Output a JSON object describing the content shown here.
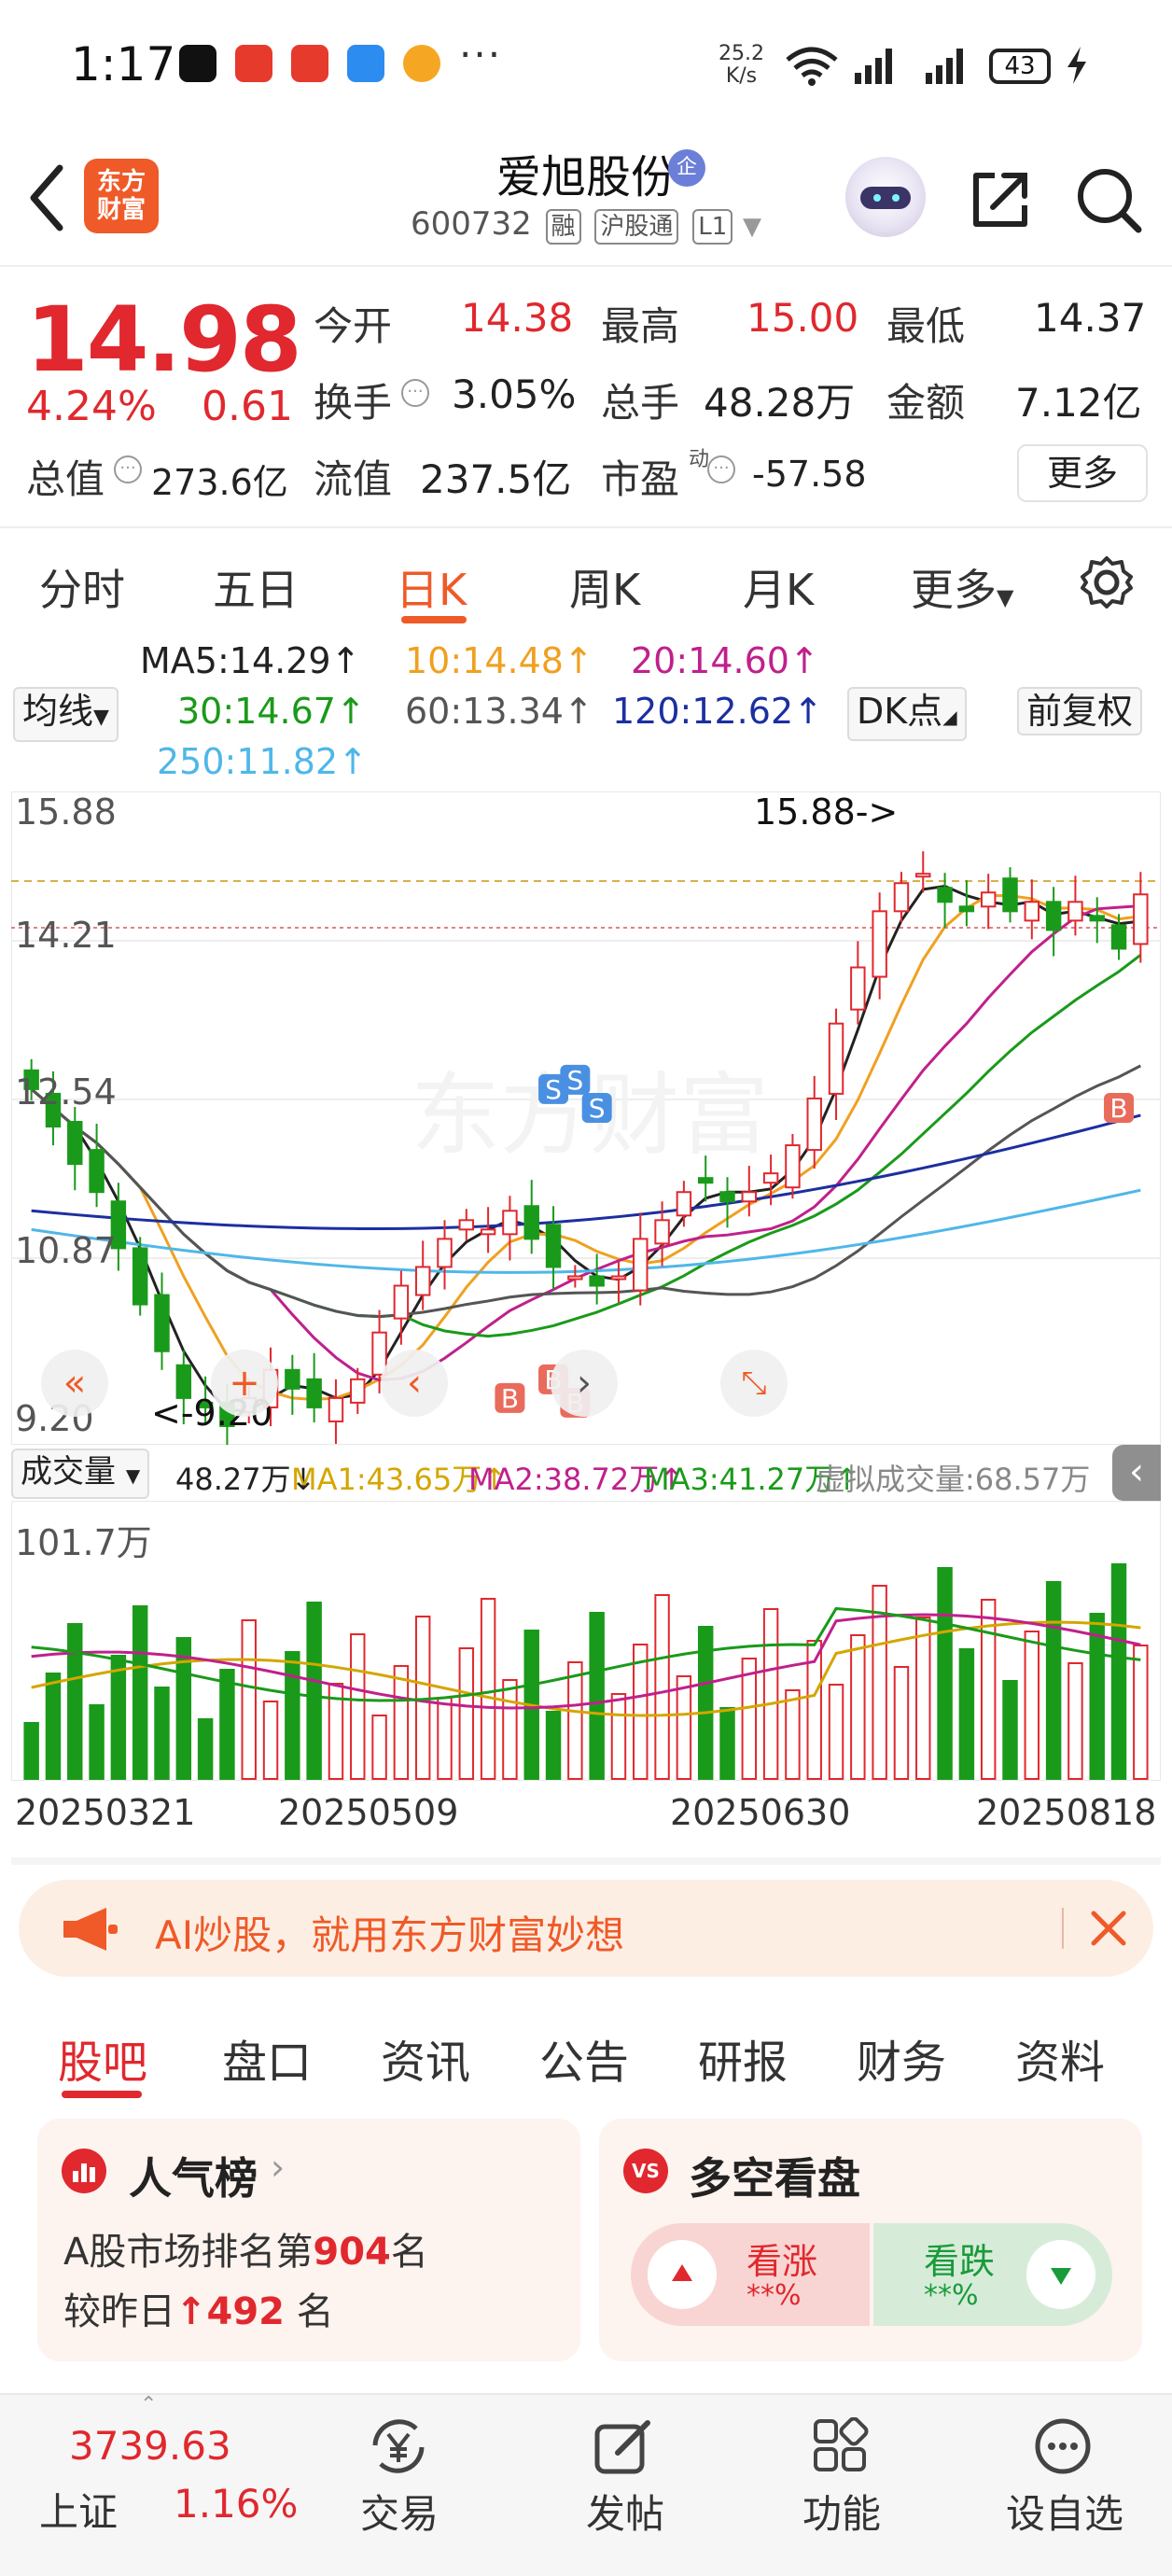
{
  "status_bar": {
    "time": "1:17",
    "dots": "···",
    "net_speed_value": "25.2",
    "net_speed_unit": "K/s",
    "battery": "43"
  },
  "header": {
    "logo_line1": "东方",
    "logo_line2": "财富",
    "stock_name": "爱旭股份",
    "enterprise_badge": "企",
    "stock_code": "600732",
    "tag_margin": "融",
    "tag_connect": "沪股通",
    "tag_level": "L1"
  },
  "quote": {
    "price": "14.98",
    "change_pct": "4.24%",
    "change_amt": "0.61",
    "open_label": "今开",
    "open": "14.38",
    "high_label": "最高",
    "high": "15.00",
    "low_label": "最低",
    "low": "14.37",
    "turnover_label": "换手",
    "turnover": "3.05%",
    "volume_label": "总手",
    "volume": "48.28万",
    "amount_label": "金额",
    "amount": "7.12亿",
    "mcap_label": "总值",
    "mcap": "273.6亿",
    "float_label": "流值",
    "float_cap": "237.5亿",
    "pe_label": "市盈",
    "pe_super": "动",
    "pe": "-57.58",
    "more": "更多"
  },
  "ktabs": [
    "分时",
    "五日",
    "日K",
    "周K",
    "月K",
    "更多"
  ],
  "ma_legend": {
    "selector": "均线",
    "ma5": "MA5:14.29↑",
    "ma10": "10:14.48↑",
    "ma20": "20:14.60↑",
    "ma30": "30:14.67↑",
    "ma60": "60:13.34↑",
    "ma120": "120:12.62↑",
    "ma250": "250:11.82↑",
    "dk": "DK点",
    "adjust": "前复权"
  },
  "colors": {
    "ma5": "#222222",
    "ma10": "#f0a020",
    "ma20": "#c0208c",
    "ma30": "#1a9a1a",
    "ma60": "#555555",
    "ma120": "#1c2fa0",
    "ma250": "#4fb7e8",
    "up": "#e0282e",
    "down": "#1a9a1a",
    "accent": "#ef5a28"
  },
  "chart": {
    "y_labels": [
      "15.88",
      "14.21",
      "12.54",
      "10.87",
      "9.20"
    ],
    "high_mark": "15.88->",
    "low_mark": "<-9.20",
    "sell_marker": "S",
    "buy_marker": "B"
  },
  "chart_data": {
    "type": "candlestick",
    "y_range": [
      9.2,
      15.88
    ],
    "x_dates": [
      "20250321",
      "20250509",
      "20250630",
      "20250818"
    ],
    "close_approx": [
      12.9,
      12.5,
      12.1,
      11.8,
      11.2,
      10.6,
      10.1,
      9.6,
      9.5,
      9.3,
      9.6,
      9.9,
      9.7,
      9.5,
      9.6,
      9.8,
      10.3,
      10.8,
      11.0,
      11.3,
      11.5,
      11.4,
      11.6,
      11.3,
      11.0,
      10.9,
      10.8,
      10.9,
      11.3,
      11.5,
      11.8,
      11.9,
      11.7,
      11.8,
      12.0,
      12.3,
      12.8,
      13.6,
      14.2,
      14.8,
      15.1,
      15.2,
      14.9,
      14.8,
      15.0,
      14.8,
      14.9,
      14.6,
      14.9,
      14.7,
      14.4,
      14.98
    ],
    "ma5": "14.29",
    "ma10": "14.48",
    "ma20": "14.60",
    "ma30": "14.67",
    "ma60": "13.34",
    "ma120": "12.62",
    "ma250": "11.82"
  },
  "volume": {
    "selector": "成交量",
    "vol": "48.27万↓",
    "ma1": "MA1:43.65万↑",
    "ma2": "MA2:38.72万↑",
    "ma3": "MA3:41.27万↑",
    "virtual": "虚拟成交量:68.57万",
    "max_label": "101.7万"
  },
  "banner": {
    "text": "AI炒股，就用东方财富妙想"
  },
  "bottom_tabs": [
    "股吧",
    "盘口",
    "资讯",
    "公告",
    "研报",
    "财务",
    "资料"
  ],
  "cards": {
    "popularity_title": "人气榜",
    "rank_prefix": "A股市场排名第",
    "rank": "904",
    "rank_suffix": "名",
    "change_prefix": "较昨日",
    "change_arrow": "↑",
    "change_val": "492",
    "change_suffix": " 名",
    "sentiment_title": "多空看盘",
    "sentiment_logo": "VS",
    "bull_label": "看涨",
    "bull_val": "**%",
    "bear_label": "看跌",
    "bear_val": "**%"
  },
  "bottom_nav": {
    "index_value": "3739.63",
    "index_name": "上证",
    "index_change": "1.16%",
    "trade": "交易",
    "post": "发帖",
    "function": "功能",
    "watchlist": "设自选"
  }
}
